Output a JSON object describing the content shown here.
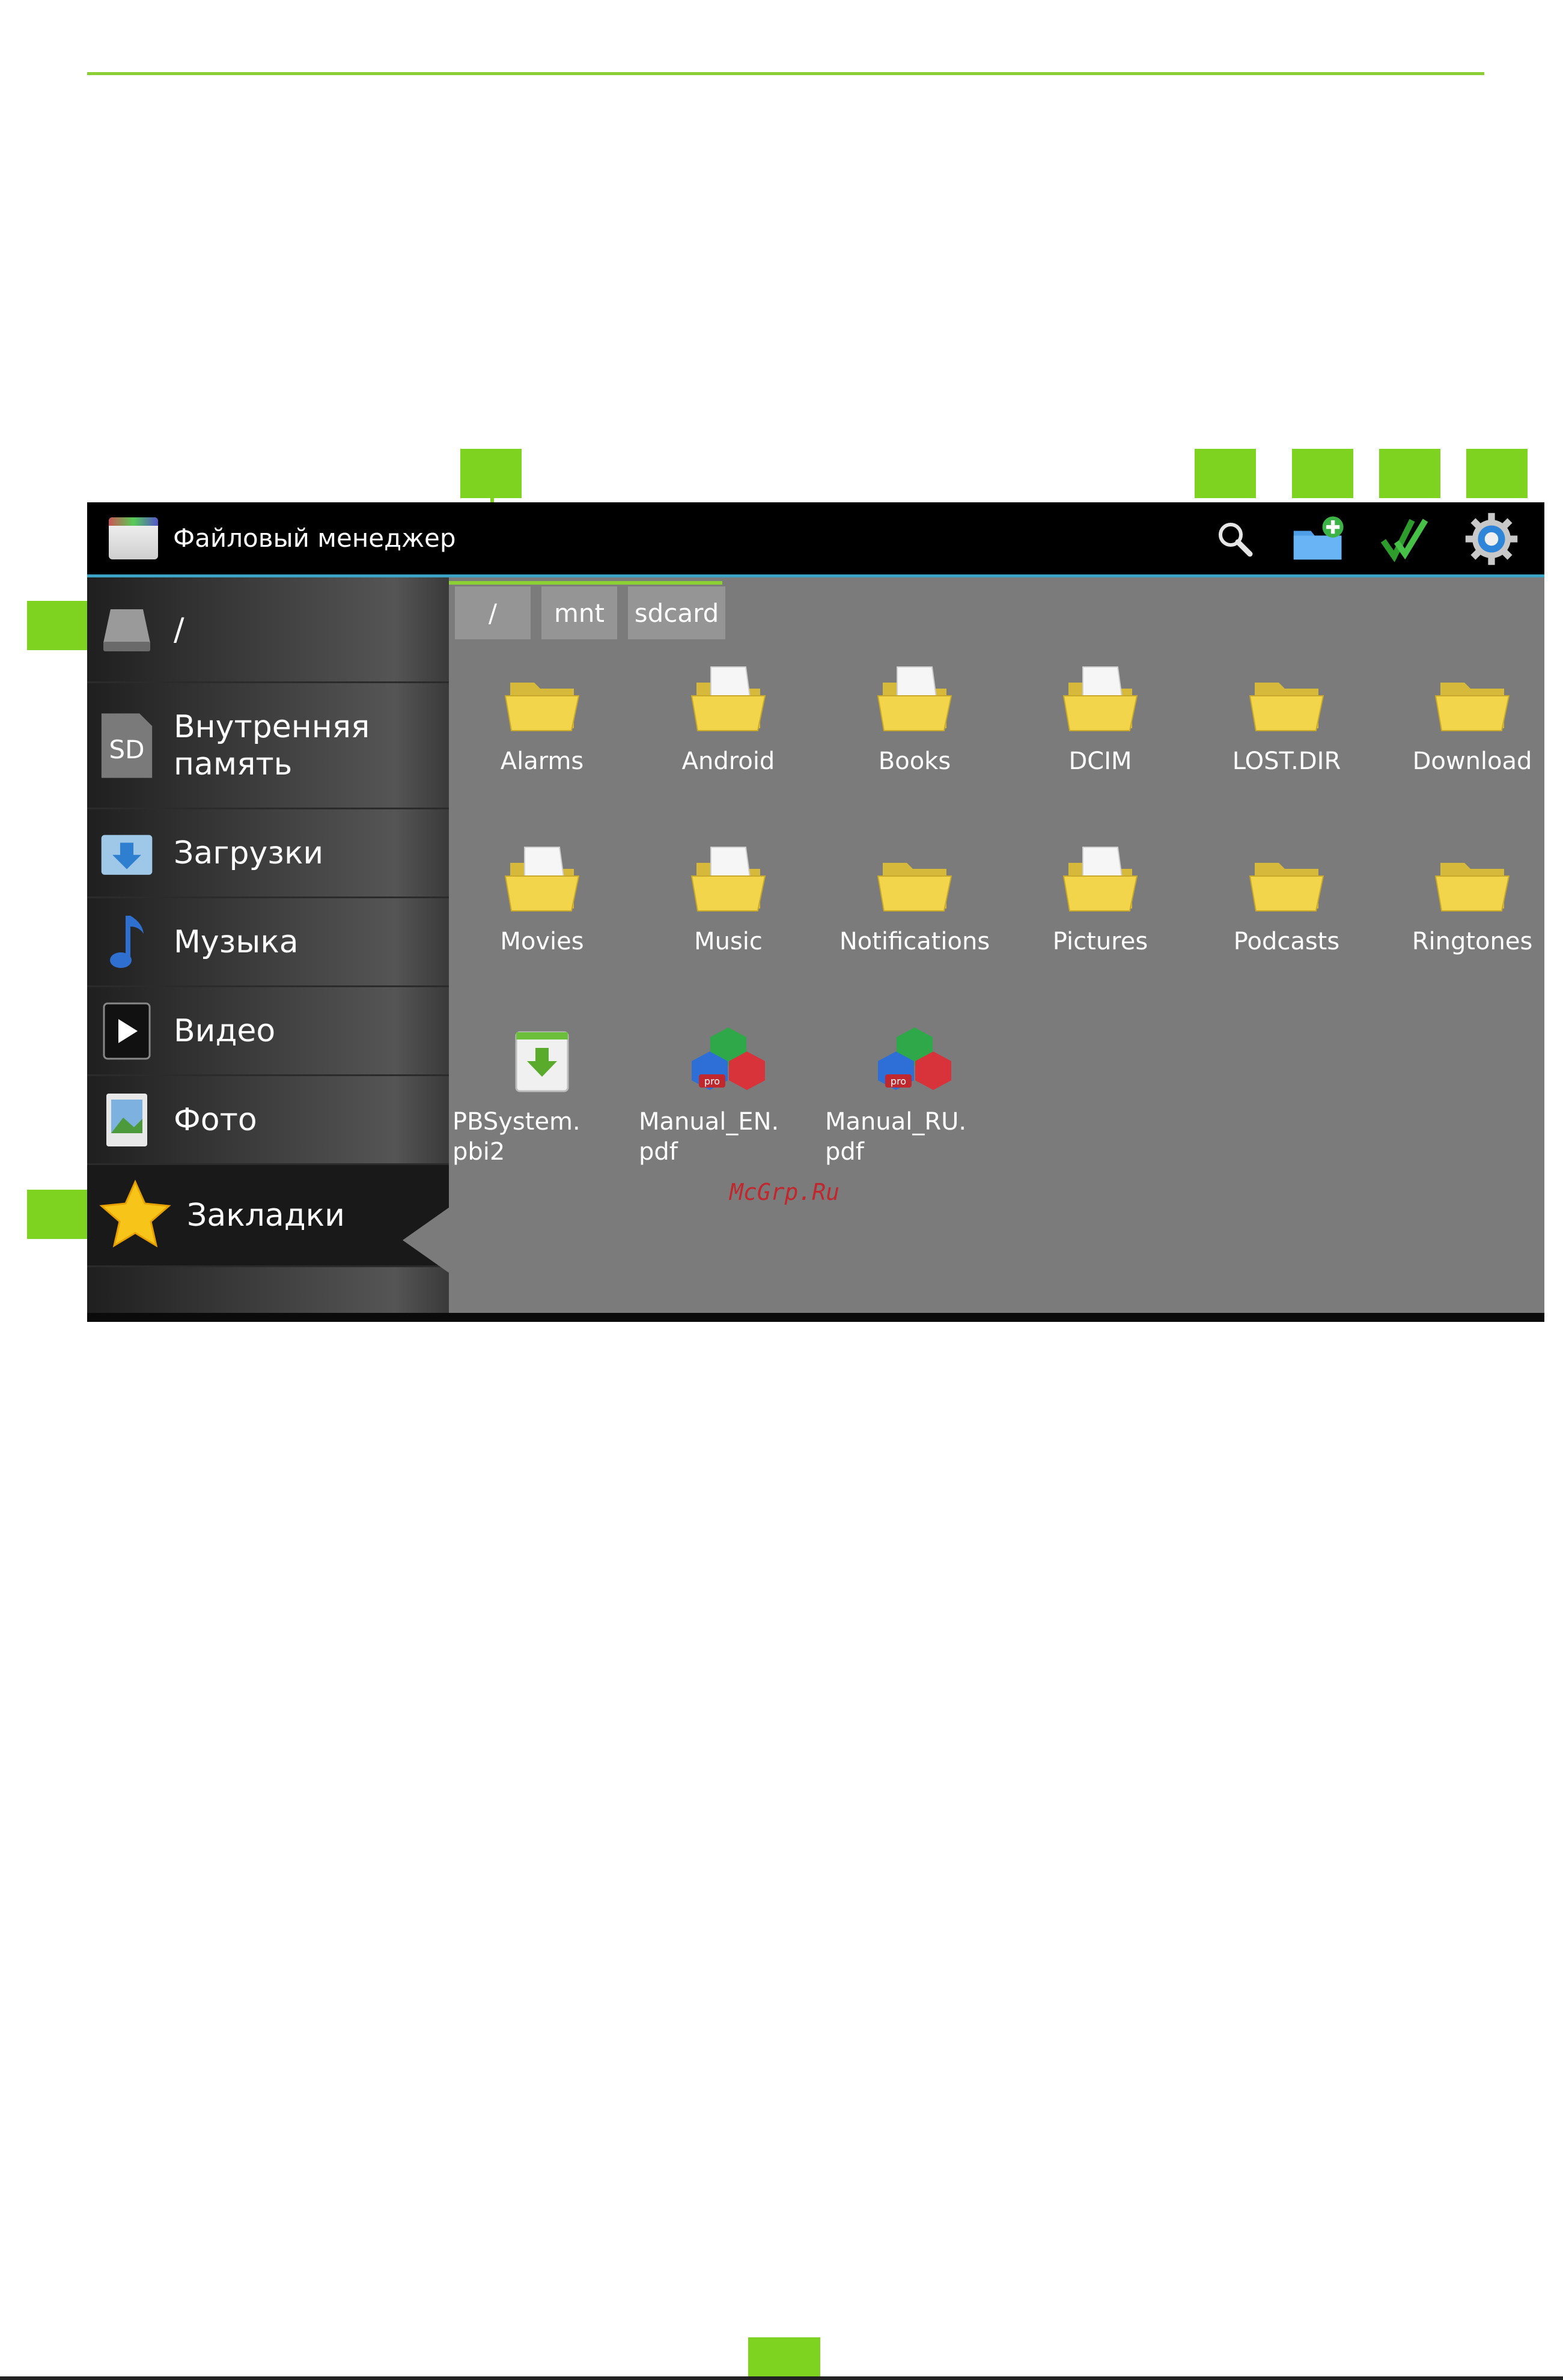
{
  "app": {
    "title": "Файловый менеджер"
  },
  "toolbar": {
    "search_icon": "search-icon",
    "new_folder_icon": "new-folder-icon",
    "select_icon": "multi-select-icon",
    "settings_icon": "settings-gear-icon"
  },
  "breadcrumb": [
    "/",
    "mnt",
    "sdcard"
  ],
  "sidebar": {
    "items": [
      {
        "label": "/",
        "icon": "drive-icon"
      },
      {
        "label": "Внутренняя\nпамять",
        "icon": "sd-card-icon"
      },
      {
        "label": "Загрузки",
        "icon": "downloads-icon"
      },
      {
        "label": "Музыка",
        "icon": "music-note-icon"
      },
      {
        "label": "Видео",
        "icon": "video-play-icon"
      },
      {
        "label": "Фото",
        "icon": "photo-icon"
      },
      {
        "label": "Закладки",
        "icon": "star-icon"
      }
    ]
  },
  "files": {
    "folders": [
      "Alarms",
      "Android",
      "Books",
      "DCIM",
      "LOST.DIR",
      "Download",
      "Movies",
      "Music",
      "Notifications",
      "Pictures",
      "Podcasts",
      "Ringtones"
    ],
    "documents": [
      "PBSystem.\npbi2",
      "Manual_EN.\npdf",
      "Manual_RU.\npdf"
    ]
  },
  "watermark": "McGrp.Ru",
  "colors": {
    "accent": "#7ed321",
    "actionbar_line": "#3aa3c6",
    "content_bg": "#7b7b7b",
    "folder": "#f2d54a"
  }
}
